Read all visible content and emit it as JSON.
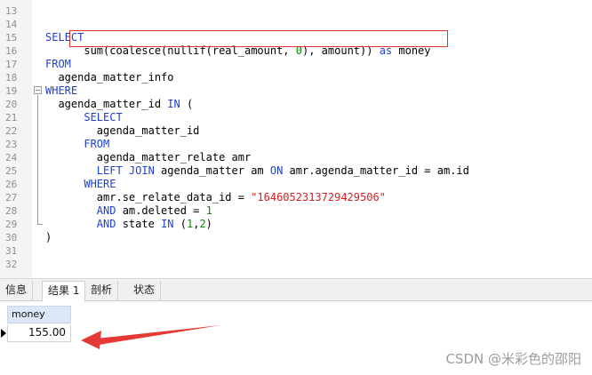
{
  "editor": {
    "lines": [
      {
        "n": "13",
        "code": []
      },
      {
        "n": "14",
        "code": []
      },
      {
        "n": "15",
        "code": [
          {
            "t": "SELECT",
            "c": "kw"
          }
        ]
      },
      {
        "n": "16",
        "code": [
          {
            "t": "      sum(coalesce(nullif(real_amount, ",
            "c": "plain"
          },
          {
            "t": "0",
            "c": "num"
          },
          {
            "t": "), amount)) ",
            "c": "plain"
          },
          {
            "t": "as",
            "c": "kw"
          },
          {
            "t": " money",
            "c": "plain"
          }
        ]
      },
      {
        "n": "17",
        "code": [
          {
            "t": "FROM",
            "c": "kw"
          }
        ]
      },
      {
        "n": "18",
        "code": [
          {
            "t": "  agenda_matter_info",
            "c": "plain"
          }
        ]
      },
      {
        "n": "19",
        "code": [
          {
            "t": "WHERE",
            "c": "kw"
          }
        ]
      },
      {
        "n": "20",
        "code": [
          {
            "t": "  agenda_matter_id ",
            "c": "plain"
          },
          {
            "t": "IN",
            "c": "kw"
          },
          {
            "t": " (",
            "c": "plain"
          }
        ]
      },
      {
        "n": "21",
        "code": [
          {
            "t": "      SELECT",
            "c": "kw"
          }
        ]
      },
      {
        "n": "22",
        "code": [
          {
            "t": "        agenda_matter_id",
            "c": "plain"
          }
        ]
      },
      {
        "n": "23",
        "code": [
          {
            "t": "      FROM",
            "c": "kw"
          }
        ]
      },
      {
        "n": "24",
        "code": [
          {
            "t": "        agenda_matter_relate amr",
            "c": "plain"
          }
        ]
      },
      {
        "n": "25",
        "code": [
          {
            "t": "        LEFT JOIN",
            "c": "kw"
          },
          {
            "t": " agenda_matter am ",
            "c": "plain"
          },
          {
            "t": "ON",
            "c": "kw"
          },
          {
            "t": " amr.agenda_matter_id = am.id",
            "c": "plain"
          }
        ]
      },
      {
        "n": "26",
        "code": [
          {
            "t": "      WHERE",
            "c": "kw"
          }
        ]
      },
      {
        "n": "27",
        "code": [
          {
            "t": "        amr.se_relate_data_id = ",
            "c": "plain"
          },
          {
            "t": "\"1646052313729429506\"",
            "c": "str"
          }
        ]
      },
      {
        "n": "28",
        "code": [
          {
            "t": "        AND",
            "c": "kw"
          },
          {
            "t": " am.deleted = ",
            "c": "plain"
          },
          {
            "t": "1",
            "c": "num"
          }
        ]
      },
      {
        "n": "29",
        "code": [
          {
            "t": "        AND",
            "c": "kw"
          },
          {
            "t": " state ",
            "c": "plain"
          },
          {
            "t": "IN",
            "c": "kw"
          },
          {
            "t": " (",
            "c": "plain"
          },
          {
            "t": "1",
            "c": "num"
          },
          {
            "t": ",",
            "c": "plain"
          },
          {
            "t": "2",
            "c": "num"
          },
          {
            "t": ")",
            "c": "plain"
          }
        ]
      },
      {
        "n": "30",
        "code": [
          {
            "t": ")",
            "c": "plain"
          }
        ]
      },
      {
        "n": "31",
        "code": []
      },
      {
        "n": "32",
        "code": []
      }
    ],
    "fold_toggle": "−"
  },
  "tabs": [
    {
      "label": "信息",
      "active": false
    },
    {
      "label": "结果 1",
      "active": true
    },
    {
      "label": "剖析",
      "active": false
    },
    {
      "label": "状态",
      "active": false
    }
  ],
  "result": {
    "column": "money",
    "value": "155.00"
  },
  "colors": {
    "keyword": "#1f3fd0",
    "number": "#0a8a0a",
    "string": "#d42020",
    "highlight_box": "#e03030",
    "arrow": "#e53935"
  },
  "watermark": "CSDN @米彩色的邵阳"
}
